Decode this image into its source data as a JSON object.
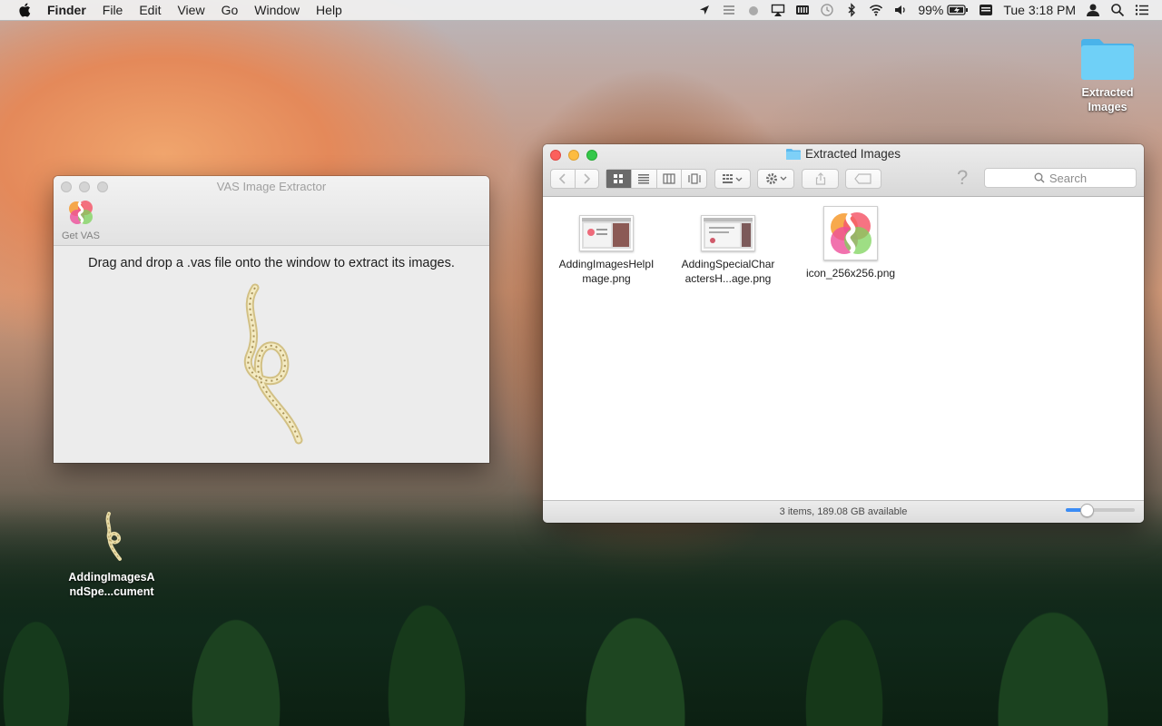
{
  "menubar": {
    "app_name": "Finder",
    "menus": [
      "File",
      "Edit",
      "View",
      "Go",
      "Window",
      "Help"
    ],
    "battery_percent": "99%",
    "clock": "Tue 3:18 PM"
  },
  "desktop": {
    "folder_label_line1": "Extracted",
    "folder_label_line2": "Images",
    "doc_label_line1": "AddingImagesA",
    "doc_label_line2": "ndSpe...cument",
    "folder_color": "#5ac8f5"
  },
  "vas_window": {
    "title": "VAS Image Extractor",
    "toolbar_button": "Get VAS",
    "instruction": "Drag and drop a .vas file onto the window to extract its images."
  },
  "finder_window": {
    "title": "Extracted Images",
    "search_placeholder": "Search",
    "help_glyph": "?",
    "files": [
      {
        "line1": "AddingImagesHelpI",
        "line2": "mage.png"
      },
      {
        "line1": "AddingSpecialChar",
        "line2": "actersH...age.png"
      },
      {
        "line1": "icon_256x256.png",
        "line2": ""
      }
    ],
    "status": "3 items, 189.08 GB available",
    "icon_size_level": 0.25,
    "accent_color": "#3b8cf5"
  }
}
